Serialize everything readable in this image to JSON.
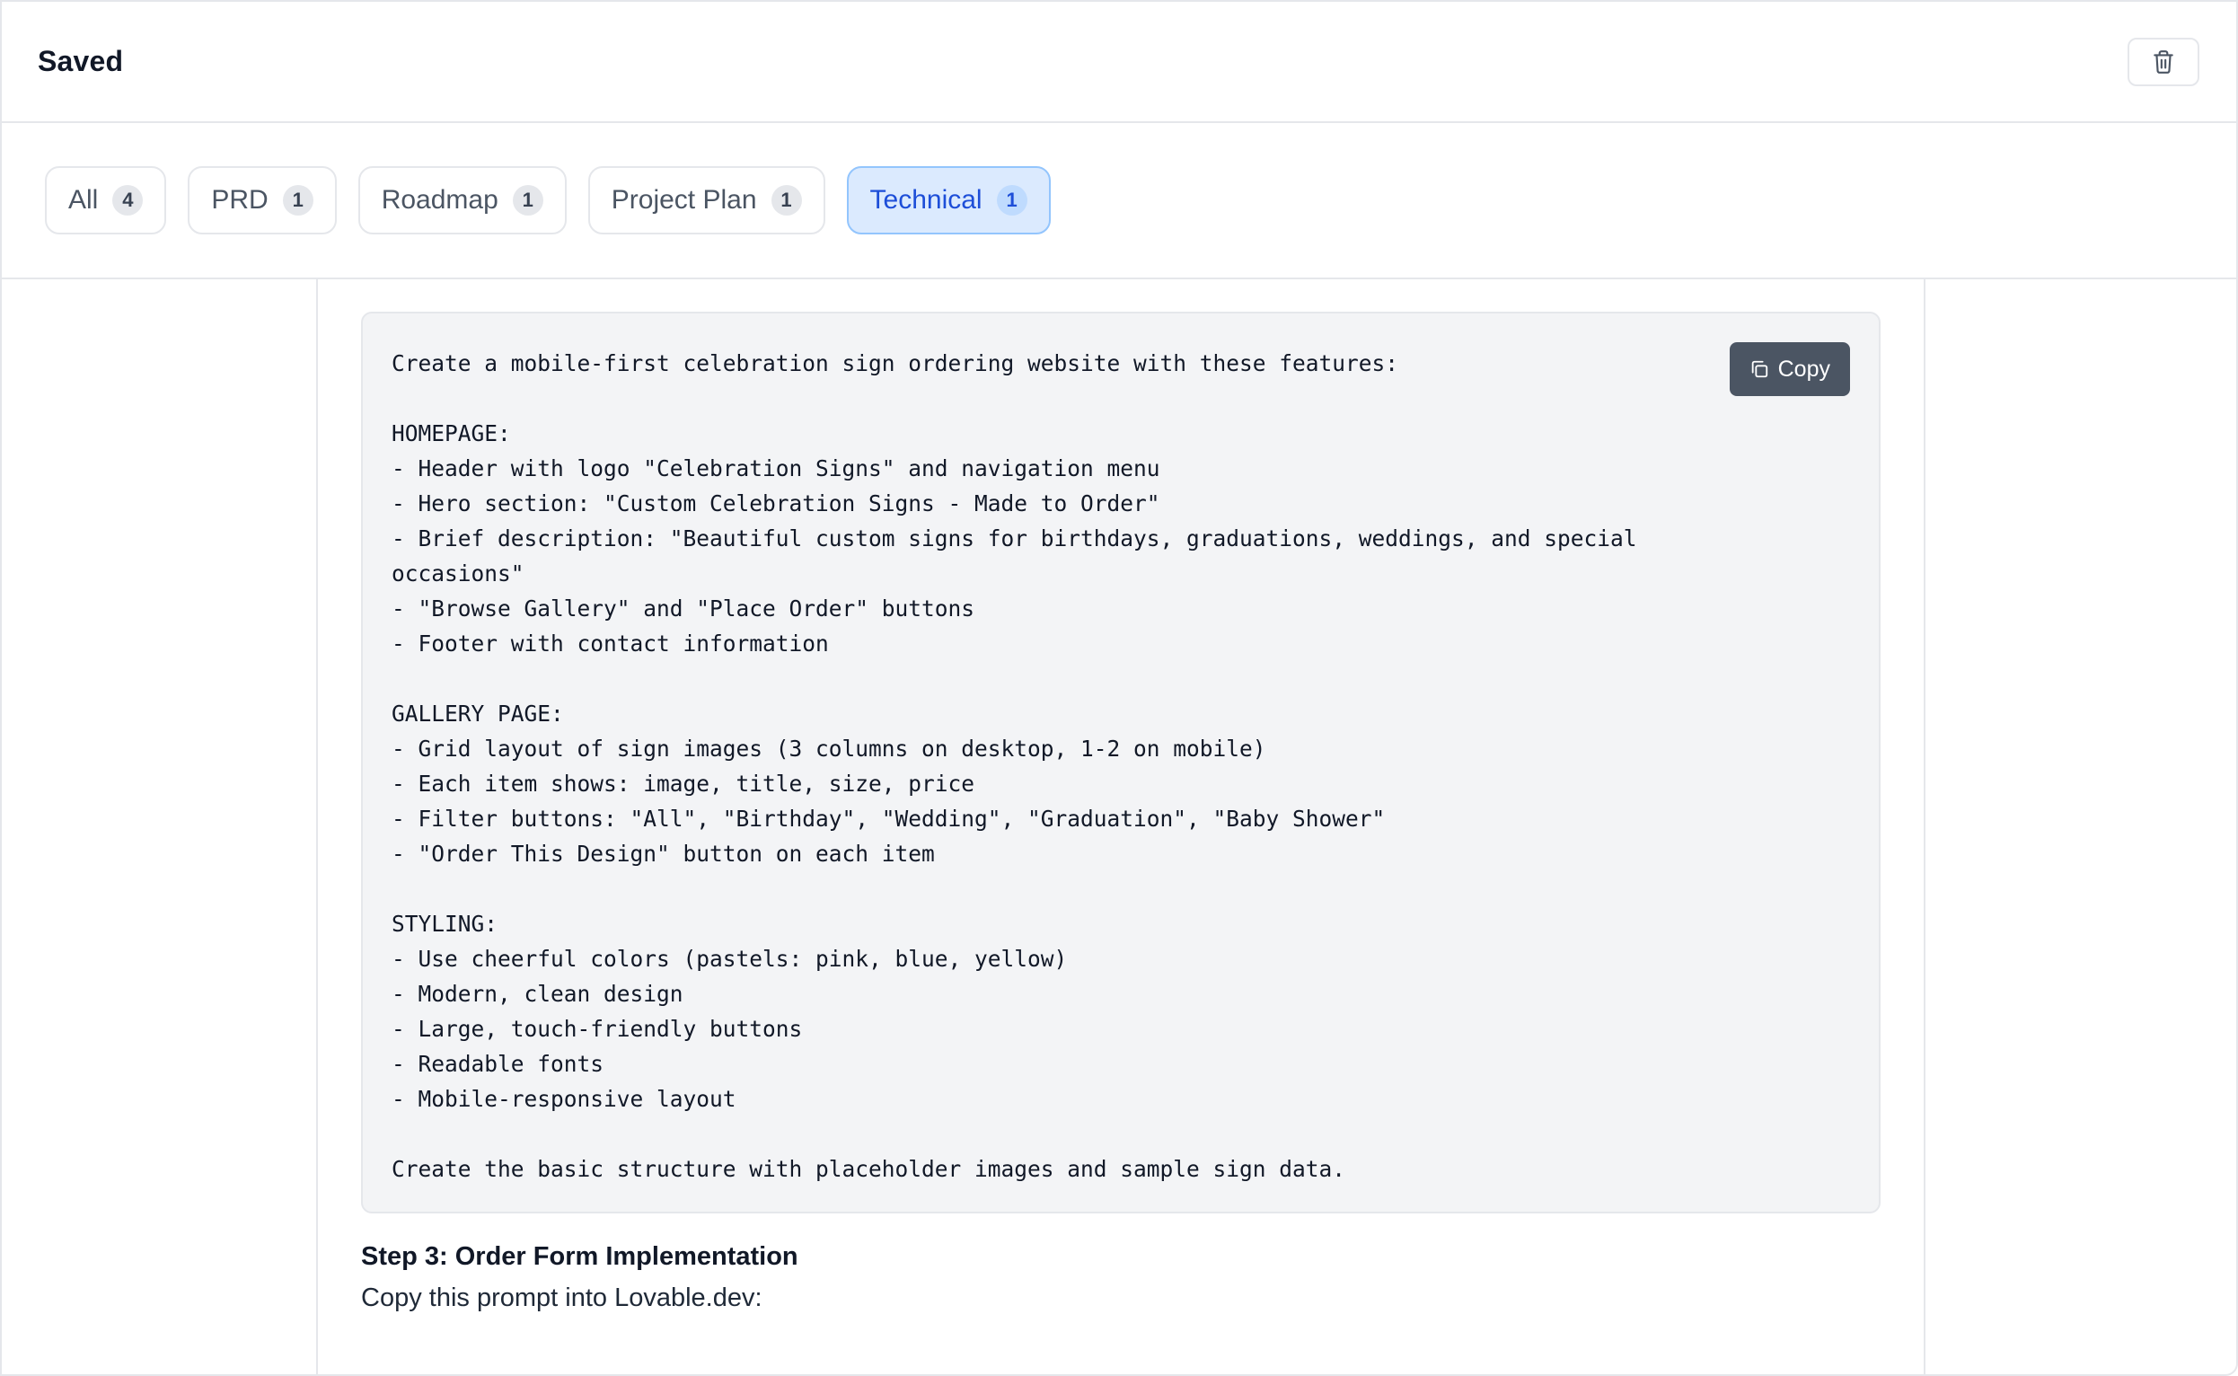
{
  "header": {
    "title": "Saved",
    "delete_icon": "trash-icon"
  },
  "tabs": [
    {
      "label": "All",
      "count": "4",
      "active": false
    },
    {
      "label": "PRD",
      "count": "1",
      "active": false
    },
    {
      "label": "Roadmap",
      "count": "1",
      "active": false
    },
    {
      "label": "Project Plan",
      "count": "1",
      "active": false
    },
    {
      "label": "Technical",
      "count": "1",
      "active": true
    }
  ],
  "code_block": {
    "copy_label": "Copy",
    "copy_icon": "copy-icon",
    "text": "Create a mobile-first celebration sign ordering website with these features:\n\nHOMEPAGE:\n- Header with logo \"Celebration Signs\" and navigation menu\n- Hero section: \"Custom Celebration Signs - Made to Order\"\n- Brief description: \"Beautiful custom signs for birthdays, graduations, weddings, and special\noccasions\"\n- \"Browse Gallery\" and \"Place Order\" buttons\n- Footer with contact information\n\nGALLERY PAGE:\n- Grid layout of sign images (3 columns on desktop, 1-2 on mobile)\n- Each item shows: image, title, size, price\n- Filter buttons: \"All\", \"Birthday\", \"Wedding\", \"Graduation\", \"Baby Shower\"\n- \"Order This Design\" button on each item\n\nSTYLING:\n- Use cheerful colors (pastels: pink, blue, yellow)\n- Modern, clean design\n- Large, touch-friendly buttons\n- Readable fonts\n- Mobile-responsive layout\n\nCreate the basic structure with placeholder images and sample sign data."
  },
  "step3": {
    "title": "Step 3: Order Form Implementation",
    "description": "Copy this prompt into Lovable.dev:"
  },
  "colors": {
    "active_tab_bg": "#dbeafe",
    "active_tab_text": "#1d4ed8",
    "copy_button_bg": "#4b5563",
    "code_bg": "#f3f4f6"
  }
}
